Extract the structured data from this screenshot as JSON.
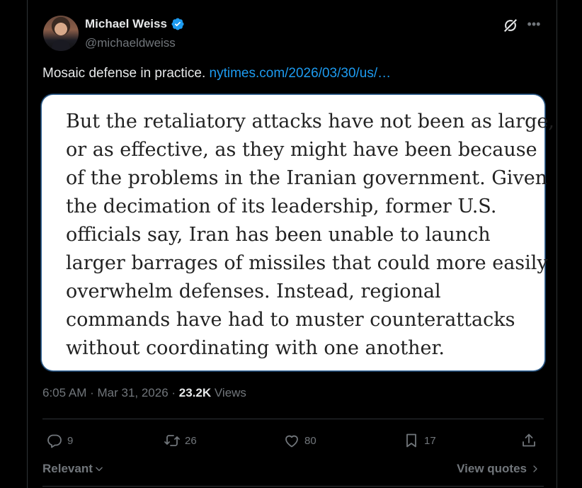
{
  "author": {
    "display_name": "Michael Weiss",
    "handle": "@michaeldweiss",
    "verified": true,
    "avatar_icon": "avatar-photo"
  },
  "tweet": {
    "text": "Mosaic defense in practice. ",
    "link_text": "nytimes.com/2026/03/30/us/…",
    "quote_lines": [
      "But the retaliatory attacks have not been as large,",
      "or as effective, as they might have been because",
      "of the problems in the Iranian government. Given",
      "the decimation of its leadership, former U.S.",
      "officials say, Iran has been unable to launch",
      "larger barrages of missiles that could more easily",
      "overwhelm defenses. Instead, regional",
      "commands have had to muster counterattacks",
      "without coordinating with one another."
    ]
  },
  "meta": {
    "time": "6:05 AM",
    "separator": " · ",
    "date": "Mar 31, 2026",
    "views_count": "23.2K",
    "views_label": " Views"
  },
  "actions": {
    "replies": "9",
    "reposts": "26",
    "likes": "80",
    "bookmarks": "17"
  },
  "footer": {
    "sort_label": "Relevant",
    "view_quotes_label": "View quotes"
  },
  "colors": {
    "background": "#000000",
    "text": "#e7e9ea",
    "muted": "#71767b",
    "link": "#1d9bf0",
    "verified": "#1d9bf0",
    "border": "#2f3336"
  }
}
